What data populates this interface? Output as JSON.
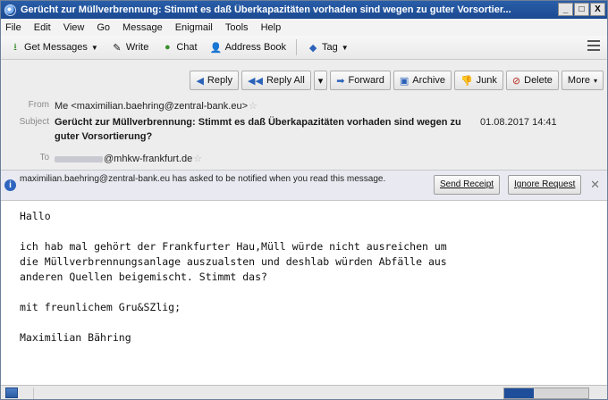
{
  "window": {
    "title": "Gerücht zur Müllverbrennung: Stimmt es daß Überkapazitäten vorhaden sind wegen zu guter Vorsortier...",
    "controls": {
      "minimize": "_",
      "maximize": "□",
      "close": "X"
    }
  },
  "menubar": [
    "File",
    "Edit",
    "View",
    "Go",
    "Message",
    "Enigmail",
    "Tools",
    "Help"
  ],
  "toolbar": {
    "get_messages": "Get Messages",
    "write": "Write",
    "chat": "Chat",
    "address_book": "Address Book",
    "tag": "Tag"
  },
  "actions": {
    "reply": "Reply",
    "reply_all": "Reply All",
    "forward": "Forward",
    "archive": "Archive",
    "junk": "Junk",
    "delete": "Delete",
    "more": "More"
  },
  "header": {
    "from_label": "From",
    "from_value": "Me <maximilian.baehring@zentral-bank.eu>",
    "subject_label": "Subject",
    "subject_value": "Gerücht zur Müllverbrennung: Stimmt es daß Überkapazitäten vorhaden sind wegen zu guter Vorsortierung?",
    "date": "01.08.2017 14:41",
    "to_label": "To",
    "to_value": "@mhkw-frankfurt.de"
  },
  "notification": {
    "text": "maximilian.baehring@zentral-bank.eu has asked to be notified when you read this message.",
    "send_receipt": "Send Receipt",
    "ignore_request": "Ignore Request"
  },
  "body": {
    "greeting": "Hallo",
    "line1": "ich hab mal gehört der Frankfurter Hau,Müll würde nicht ausreichen um",
    "line2": "die Müllverbrennungsanlage auszualsten und deshlab würden Abfälle aus",
    "line3": "anderen Quellen beigemischt. Stimmt das?",
    "closing": "mit freunlichem Gru&SZlig;",
    "signature": "Maximilian Bähring"
  },
  "status": {
    "progress_fraction": 0.35
  }
}
